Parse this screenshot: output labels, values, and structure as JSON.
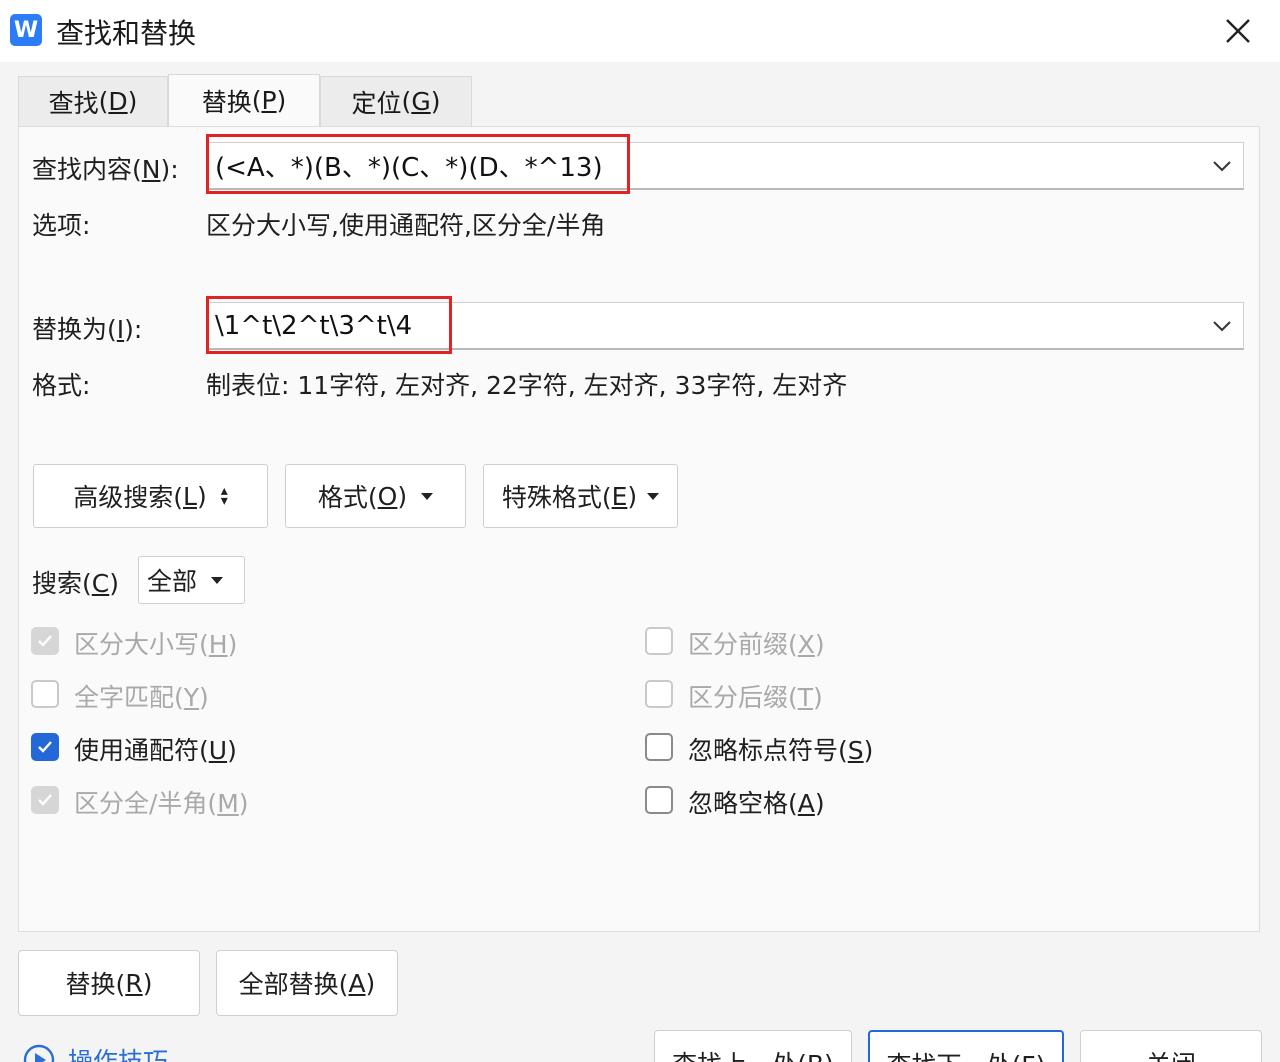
{
  "window": {
    "logo_letter": "W",
    "title": "查找和替换"
  },
  "tabs": [
    {
      "label": "查找",
      "key": "D"
    },
    {
      "label": "替换",
      "key": "P"
    },
    {
      "label": "定位",
      "key": "G"
    }
  ],
  "find": {
    "label": "查找内容(",
    "key": "N",
    "label_end": "):",
    "value": "(<A、*)(B、*)(C、*)(D、*^13)"
  },
  "options": {
    "label": "选项:",
    "value": "区分大小写,使用通配符,区分全/半角"
  },
  "replace": {
    "label": "替换为(",
    "key": "I",
    "label_end": "):",
    "value": "\\1^t\\2^t\\3^t\\4"
  },
  "format": {
    "label": "格式:",
    "value": "制表位: 11字符, 左对齐, 22字符, 左对齐, 33字符, 左对齐"
  },
  "buttons": {
    "advanced": {
      "label": "高级搜索(",
      "key": "L",
      "end": ")"
    },
    "format": {
      "label": "格式(",
      "key": "O",
      "end": ")"
    },
    "special": {
      "label": "特殊格式(",
      "key": "E",
      "end": ")"
    }
  },
  "search": {
    "label": "搜索(",
    "key": "C",
    "end": ")",
    "selected": "全部"
  },
  "checkboxes": [
    {
      "label": "区分大小写(",
      "key": "H",
      "end": ")",
      "state": "checked-disabled"
    },
    {
      "label": "全字匹配(",
      "key": "Y",
      "end": ")",
      "state": "disabled"
    },
    {
      "label": "使用通配符(",
      "key": "U",
      "end": ")",
      "state": "checked"
    },
    {
      "label": "区分全/半角(",
      "key": "M",
      "end": ")",
      "state": "checked-disabled"
    },
    {
      "label": "区分前缀(",
      "key": "X",
      "end": ")",
      "state": "disabled"
    },
    {
      "label": "区分后缀(",
      "key": "T",
      "end": ")",
      "state": "disabled"
    },
    {
      "label": "忽略标点符号(",
      "key": "S",
      "end": ")",
      "state": "unchecked"
    },
    {
      "label": "忽略空格(",
      "key": "A",
      "end": ")",
      "state": "unchecked"
    }
  ],
  "actions": {
    "replace": {
      "label": "替换(",
      "key": "R",
      "end": ")"
    },
    "replace_all": {
      "label": "全部替换(",
      "key": "A",
      "end": ")"
    }
  },
  "footer": {
    "tips": "操作技巧",
    "find_prev": "查找上一处(B)",
    "find_next": "查找下一处(F)",
    "close": "关闭"
  },
  "colors": {
    "accent": "#2467d6",
    "highlight": "#e02424"
  }
}
